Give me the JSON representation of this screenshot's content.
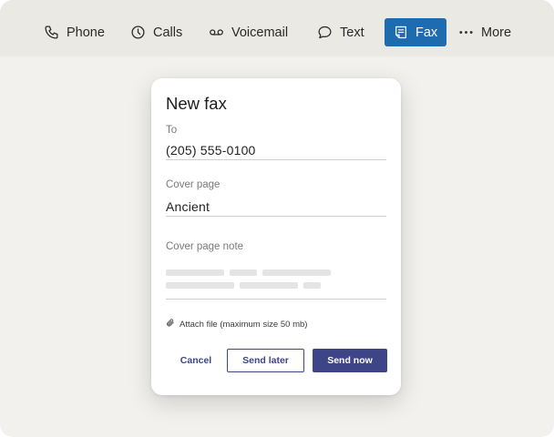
{
  "nav": {
    "items": [
      {
        "label": "Phone",
        "icon": "phone-icon"
      },
      {
        "label": "Calls",
        "icon": "clock-icon"
      },
      {
        "label": "Voicemail",
        "icon": "voicemail-icon"
      },
      {
        "label": "Text",
        "icon": "chat-bubble-icon"
      },
      {
        "label": "Fax",
        "icon": "fax-document-icon",
        "active": true
      },
      {
        "label": "More",
        "icon": "more-dots-icon"
      }
    ],
    "active_color": "#1f6bb0"
  },
  "dialog": {
    "title": "New fax",
    "to": {
      "label": "To",
      "value": "(205) 555-0100"
    },
    "cover_page": {
      "label": "Cover page",
      "value": "Ancient"
    },
    "cover_note": {
      "label": "Cover page note",
      "value": ""
    },
    "attach": {
      "label": "Attach file (maximum size 50 mb)",
      "icon": "paperclip-icon"
    },
    "buttons": {
      "cancel": "Cancel",
      "send_later": "Send later",
      "send_now": "Send now"
    },
    "accent_color": "#3d4587"
  }
}
